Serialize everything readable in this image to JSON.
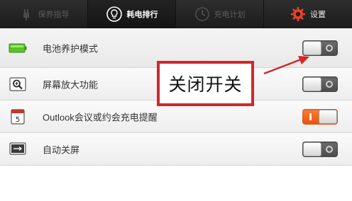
{
  "tabs": [
    {
      "id": "save",
      "label": "保养指导",
      "icon": "power-plug-icon",
      "active": false
    },
    {
      "id": "rank",
      "label": "耗电排行",
      "icon": "lightbulb-icon",
      "active": true
    },
    {
      "id": "plan",
      "label": "充电计划",
      "icon": "clock-icon",
      "active": false
    },
    {
      "id": "settings",
      "label": "设置",
      "icon": "gear-icon",
      "active": false
    }
  ],
  "settings": [
    {
      "label": "电池养护模式",
      "icon": "battery-icon",
      "toggle": "off"
    },
    {
      "label": "屏幕放大功能",
      "icon": "magnifier-icon",
      "toggle": "off"
    },
    {
      "label": "Outlook会议或约会充电提醒",
      "icon": "calendar-icon",
      "toggle": "on"
    },
    {
      "label": "自动关屏",
      "icon": "screen-off-icon",
      "toggle": "off"
    }
  ],
  "annotation": {
    "text": "关闭开关"
  },
  "colors": {
    "accent": "#ff6a1f",
    "annotation_border": "#d3262c",
    "tabbar": "#1e1e1e"
  }
}
